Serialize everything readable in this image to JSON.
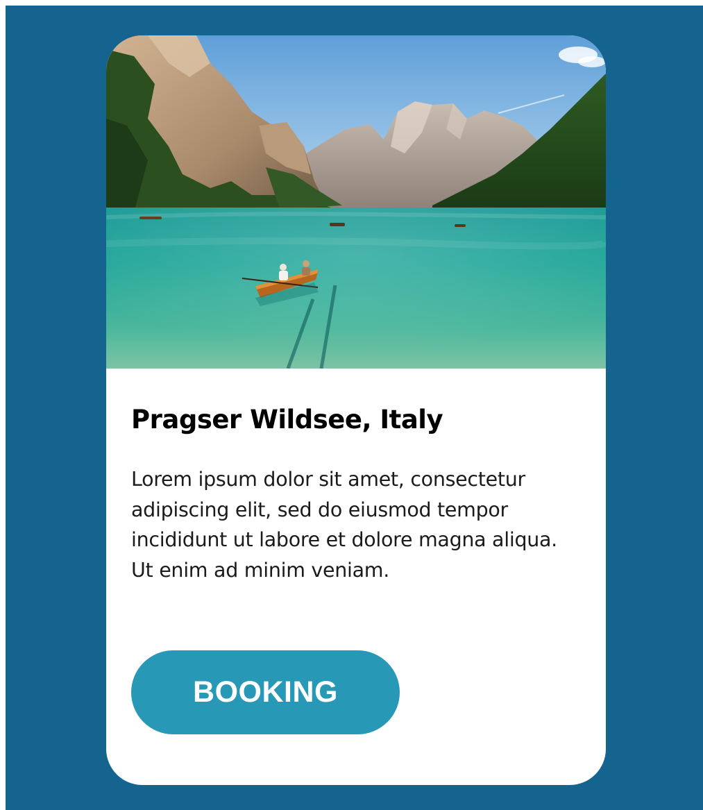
{
  "card": {
    "image_alt": "Lake with rowboats surrounded by mountains",
    "title": "Pragser Wildsee, Italy",
    "description": "Lorem ipsum dolor sit amet, consectetur adipiscing elit, sed do eiusmod tempor incididunt ut labore et dolore magna aliqua. Ut enim ad minim veniam.",
    "button_label": "BOOKING"
  },
  "colors": {
    "page_background": "#15648f",
    "card_background": "#ffffff",
    "button_background": "#2898b7",
    "button_text": "#ffffff",
    "title_text": "#000000",
    "body_text": "#1b1b1b"
  }
}
